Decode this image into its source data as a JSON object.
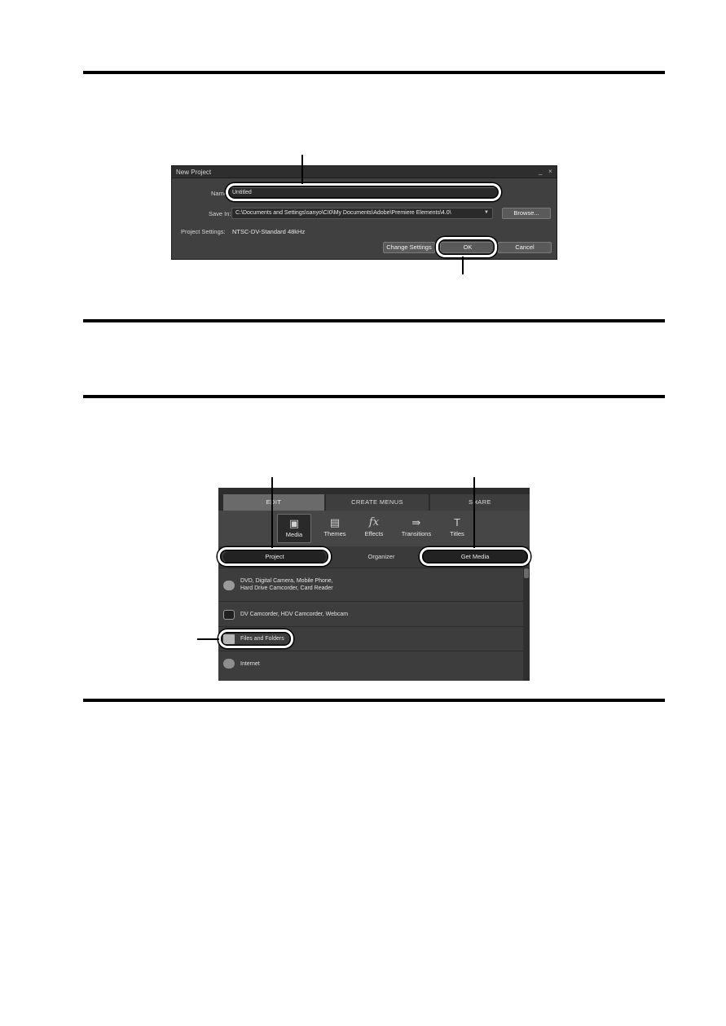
{
  "dialog": {
    "title": "New Project",
    "minimize_glyph": "_",
    "close_glyph": "×",
    "name_label": "Name:",
    "name_value": "Untitled",
    "save_in_label": "Save In:",
    "save_in_value": "C:\\Documents and Settings\\sanyo\\CI0\\My Documents\\Adobe\\Premiere Elements\\4.0\\",
    "browse_label": "Browse...",
    "project_settings_label": "Project Settings:",
    "project_settings_value": "NTSC-DV-Standard 48kHz",
    "change_settings_label": "Change Settings",
    "ok_label": "OK",
    "cancel_label": "Cancel"
  },
  "panel": {
    "tabs": {
      "edit": "EDIT",
      "create_menus": "CREATE MENUS",
      "share": "SHARE"
    },
    "tools": [
      {
        "label": "Media",
        "icon": "media-icon",
        "glyph": "▣"
      },
      {
        "label": "Themes",
        "icon": "themes-icon",
        "glyph": "▤"
      },
      {
        "label": "Effects",
        "icon": "effects-icon",
        "glyph": "fx"
      },
      {
        "label": "Transitions",
        "icon": "transitions-icon",
        "glyph": "⇛"
      },
      {
        "label": "Titles",
        "icon": "titles-icon",
        "glyph": "T"
      }
    ],
    "subtabs": {
      "project": "Project",
      "organizer": "Organizer",
      "get_media": "Get Media"
    },
    "items": [
      {
        "line1": "DVD, Digital Camera, Mobile Phone,",
        "line2": "Hard Drive Camcorder, Card Reader",
        "icon": "dvd-camera-icon"
      },
      {
        "line1": "DV Camcorder, HDV Camcorder, Webcam",
        "line2": "",
        "icon": "camcorder-icon"
      },
      {
        "line1": "Files and Folders",
        "line2": "",
        "icon": "folder-icon"
      },
      {
        "line1": "Internet",
        "line2": "",
        "icon": "globe-icon"
      }
    ]
  }
}
